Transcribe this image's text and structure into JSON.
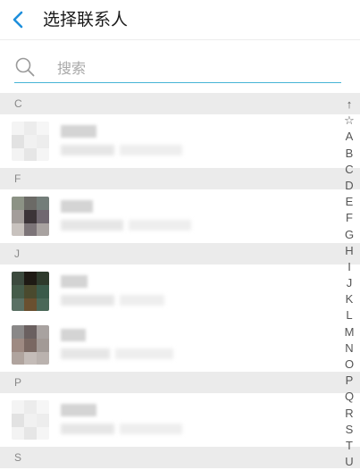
{
  "header": {
    "title": "选择联系人",
    "back_icon": "chevron-left-icon",
    "accent": "#1e8fdc"
  },
  "search": {
    "placeholder": "搜索",
    "value": "",
    "icon": "search-icon",
    "underline_color": "#47b4d6"
  },
  "sections": [
    {
      "letter": "C",
      "contacts": [
        {
          "avatar_colors": [
            "#f4f4f4",
            "#ececec",
            "#f6f6f6",
            "#e2e2e2",
            "#f1f1f1",
            "#ededed",
            "#f3f3f3",
            "#e6e6e6",
            "#f5f5f5"
          ]
        }
      ]
    },
    {
      "letter": "F",
      "contacts": [
        {
          "avatar_colors": [
            "#8c9285",
            "#6b6a66",
            "#737d79",
            "#a39d9a",
            "#3c3438",
            "#706870",
            "#c8c2be",
            "#7c7478",
            "#a8a2a0"
          ]
        }
      ]
    },
    {
      "letter": "J",
      "contacts": [
        {
          "avatar_colors": [
            "#3c4a3e",
            "#1e1a14",
            "#2e3a2c",
            "#455c4a",
            "#4a4a2e",
            "#3a5a4a",
            "#5a7064",
            "#6a5030",
            "#4a6858"
          ]
        },
        {
          "avatar_colors": [
            "#8a8888",
            "#6a6060",
            "#a8a2a0",
            "#9e8a82",
            "#7a6862",
            "#a29a96",
            "#b0a49e",
            "#c4bcb8",
            "#bab2ae"
          ]
        }
      ]
    },
    {
      "letter": "P",
      "contacts": [
        {
          "avatar_colors": [
            "#f4f4f4",
            "#ececec",
            "#f6f6f6",
            "#e2e2e2",
            "#f1f1f1",
            "#ededed",
            "#f3f3f3",
            "#e6e6e6",
            "#f5f5f5"
          ]
        }
      ]
    },
    {
      "letter": "S",
      "contacts": []
    }
  ],
  "index_bar": [
    "↑",
    "☆",
    "A",
    "B",
    "C",
    "D",
    "E",
    "F",
    "G",
    "H",
    "I",
    "J",
    "K",
    "L",
    "M",
    "N",
    "O",
    "P",
    "Q",
    "R",
    "S",
    "T",
    "U"
  ]
}
